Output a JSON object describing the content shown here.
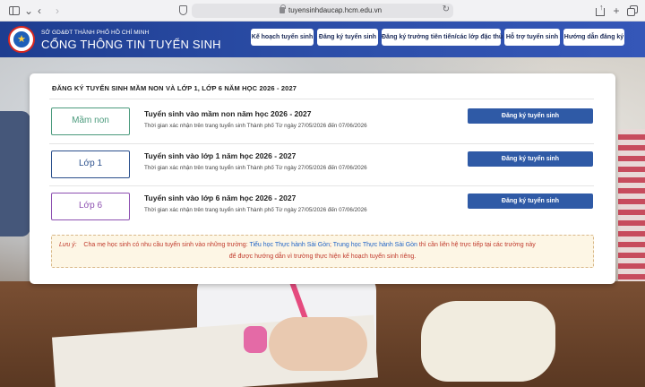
{
  "browser": {
    "url": "tuyensinhdaucap.hcm.edu.vn"
  },
  "header": {
    "org": "SỞ GD&ĐT THÀNH PHỐ HỒ CHÍ MINH",
    "portal": "CỔNG THÔNG TIN TUYỂN SINH",
    "nav": [
      "Kế hoạch tuyển sinh",
      "Đăng ký tuyển sinh",
      "Đăng ký trường tiên tiến/các lớp đặc thù",
      "Hỗ trợ tuyển sinh",
      "Hướng dẫn đăng ký"
    ]
  },
  "card": {
    "title": "ĐĂNG KÝ TUYỂN SINH MẦM NON VÀ LỚP 1, LỚP 6 NĂM HỌC 2026 - 2027",
    "rows": [
      {
        "grade": "Mầm non",
        "title": "Tuyển sinh vào mầm non năm học 2026 - 2027",
        "sub": "Thời gian xác nhận trên trang tuyển sinh Thành phố Từ ngày 27/05/2026 đến 07/06/2026",
        "button": "Đăng ký tuyển sinh",
        "color": "#4a9a7c"
      },
      {
        "grade": "Lớp 1",
        "title": "Tuyển sinh vào lớp 1 năm học 2026 - 2027",
        "sub": "Thời gian xác nhận trên trang tuyển sinh Thành phố Từ ngày 27/05/2026 đến 07/06/2026",
        "button": "Đăng ký tuyển sinh",
        "color": "#2a4f8c"
      },
      {
        "grade": "Lớp 6",
        "title": "Tuyển sinh vào lớp 6 năm học 2026 - 2027",
        "sub": "Thời gian xác nhận trên trang tuyển sinh Thành phố Từ ngày 27/05/2026 đến 07/06/2026",
        "button": "Đăng ký tuyển sinh",
        "color": "#8c4fb0"
      }
    ],
    "note": {
      "label": "Lưu ý:",
      "text1": "Cha mẹ học sinh có nhu cầu tuyển sinh vào những trường: ",
      "link1": "Tiểu học Thực hành Sài Gòn",
      "sep": "; ",
      "link2": "Trung học Thực hành Sài Gòn",
      "text2": " thì cần liên hệ trực tiếp tại các trường này",
      "line2": "để được hướng dẫn vì trường thực hiện kế hoạch tuyển sinh riêng."
    }
  },
  "colors": {
    "header": "#2c4ea8",
    "button": "#2f5aa6",
    "note_text": "#c0392b",
    "link": "#1f63c6"
  }
}
